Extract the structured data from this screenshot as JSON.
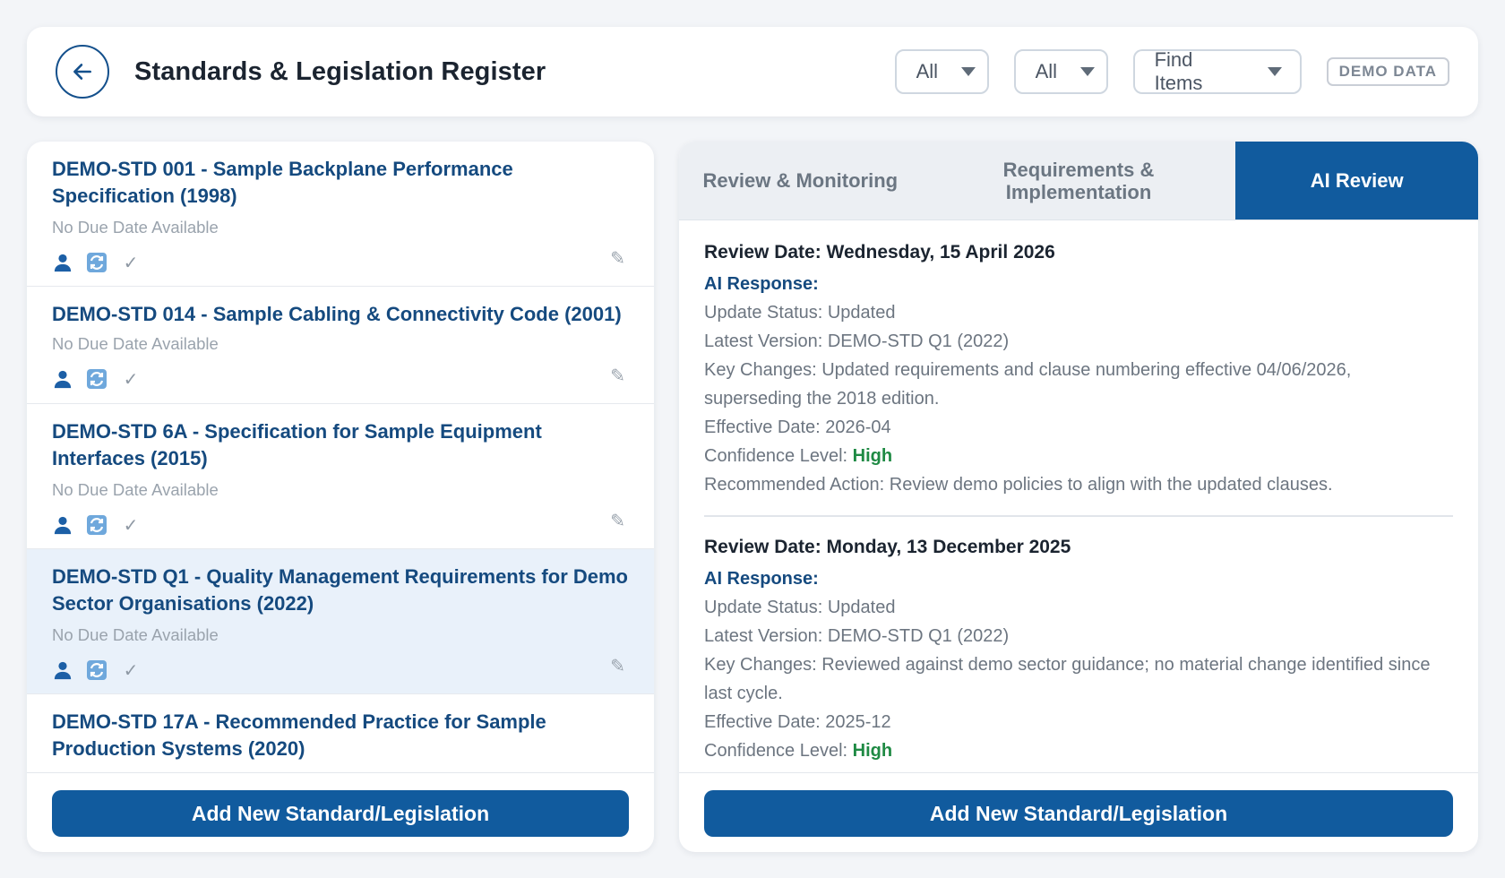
{
  "header": {
    "title": "Standards & Legislation Register",
    "filters": [
      {
        "selected": "All"
      },
      {
        "selected": "All"
      },
      {
        "selected": "Find Items"
      }
    ],
    "badge": "DEMO DATA",
    "icons": {
      "back": "arrow-left-icon"
    }
  },
  "standards": {
    "items": [
      {
        "title": "DEMO-STD 001 - Sample Backplane Performance Specification (1998)",
        "due": "No Due Date Available"
      },
      {
        "title": "DEMO-STD 014 - Sample Cabling & Connectivity Code (2001)",
        "due": "No Due Date Available"
      },
      {
        "title": "DEMO-STD 6A - Specification for Sample Equipment Interfaces (2015)",
        "due": "No Due Date Available"
      },
      {
        "title": "DEMO-STD Q1 - Quality Management Requirements for Demo Sector Organisations (2022)",
        "due": "No Due Date Available",
        "selected": true
      },
      {
        "title": "DEMO-STD 17A - Recommended Practice for Sample Production Systems (2020)",
        "due": ""
      }
    ],
    "row_icons": [
      "user-icon",
      "sync-icon",
      "check-icon",
      "pencil-icon"
    ],
    "add_button": "Add New Standard/Legislation"
  },
  "details": {
    "tabs": [
      {
        "label": "Review & Monitoring"
      },
      {
        "label": "Requirements & Implementation"
      },
      {
        "label": "AI Review",
        "active": true
      }
    ],
    "reviews": [
      {
        "date": "Review Date: Wednesday, 15 April 2026",
        "ai_label": "AI Response:",
        "update_status": "Update Status: Updated",
        "latest_version": "Latest Version: DEMO-STD Q1 (2022)",
        "key_changes": "Key Changes: Updated requirements and clause numbering effective 04/06/2026, superseding the 2018 edition.",
        "effective_date": "Effective Date: 2026-04",
        "confidence_label": "Confidence Level: ",
        "confidence_value": "High",
        "recommended_action": "Recommended Action: Review demo policies to align with the updated clauses."
      },
      {
        "date": "Review Date: Monday, 13 December 2025",
        "ai_label": "AI Response:",
        "update_status": "Update Status: Updated",
        "latest_version": "Latest Version: DEMO-STD Q1 (2022)",
        "key_changes": "Key Changes: Reviewed against demo sector guidance; no material change identified since last cycle.",
        "effective_date": "Effective Date: 2025-12",
        "confidence_label": "Confidence Level: ",
        "confidence_value": "High"
      }
    ],
    "add_button": "Add New Standard/Legislation"
  },
  "colors": {
    "primary": "#115b9e",
    "title_blue": "#154a7f",
    "selected_row": "#e9f1fa",
    "confidence_high": "#1f8a44"
  }
}
